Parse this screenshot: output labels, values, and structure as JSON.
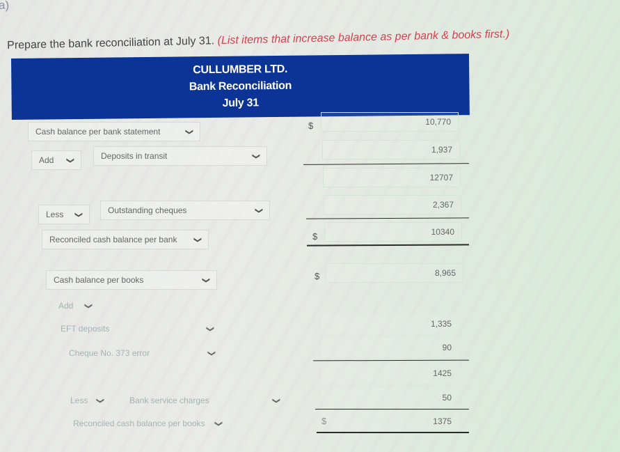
{
  "part_label": "a)",
  "instruction": {
    "text": "Prepare the bank reconciliation at July 31.",
    "hint": "(List items that increase balance as per bank & books first.)"
  },
  "header": {
    "company": "CULLUMBER LTD.",
    "title": "Bank Reconciliation",
    "date": "July 31",
    "color": "#0b3496"
  },
  "bank_section": {
    "opening": {
      "label": "Cash balance per bank statement",
      "currency": "$",
      "amount": "10,770"
    },
    "add": {
      "operator": "Add",
      "item": "Deposits in transit",
      "amount": "1,937"
    },
    "subtotal": {
      "amount": "12707"
    },
    "less": {
      "operator": "Less",
      "item": "Outstanding cheques",
      "amount": "2,367"
    },
    "reconciled": {
      "label": "Reconciled cash balance per bank",
      "currency": "$",
      "amount": "10340"
    }
  },
  "books_section": {
    "opening": {
      "label": "Cash balance per books",
      "currency": "$",
      "amount": "8,965"
    },
    "add": {
      "operator": "Add",
      "items": [
        {
          "item": "EFT deposits",
          "amount": "1,335"
        },
        {
          "item": "Cheque No. 373 error",
          "amount": "90"
        }
      ]
    },
    "subtotal": {
      "amount": "1425"
    },
    "less": {
      "operator": "Less",
      "item": "Bank service charges",
      "amount": "50"
    },
    "reconciled": {
      "label": "Reconciled cash balance per books",
      "currency": "$",
      "amount": "1375"
    }
  },
  "icons": {
    "dropdown": "chevron-down-icon"
  }
}
